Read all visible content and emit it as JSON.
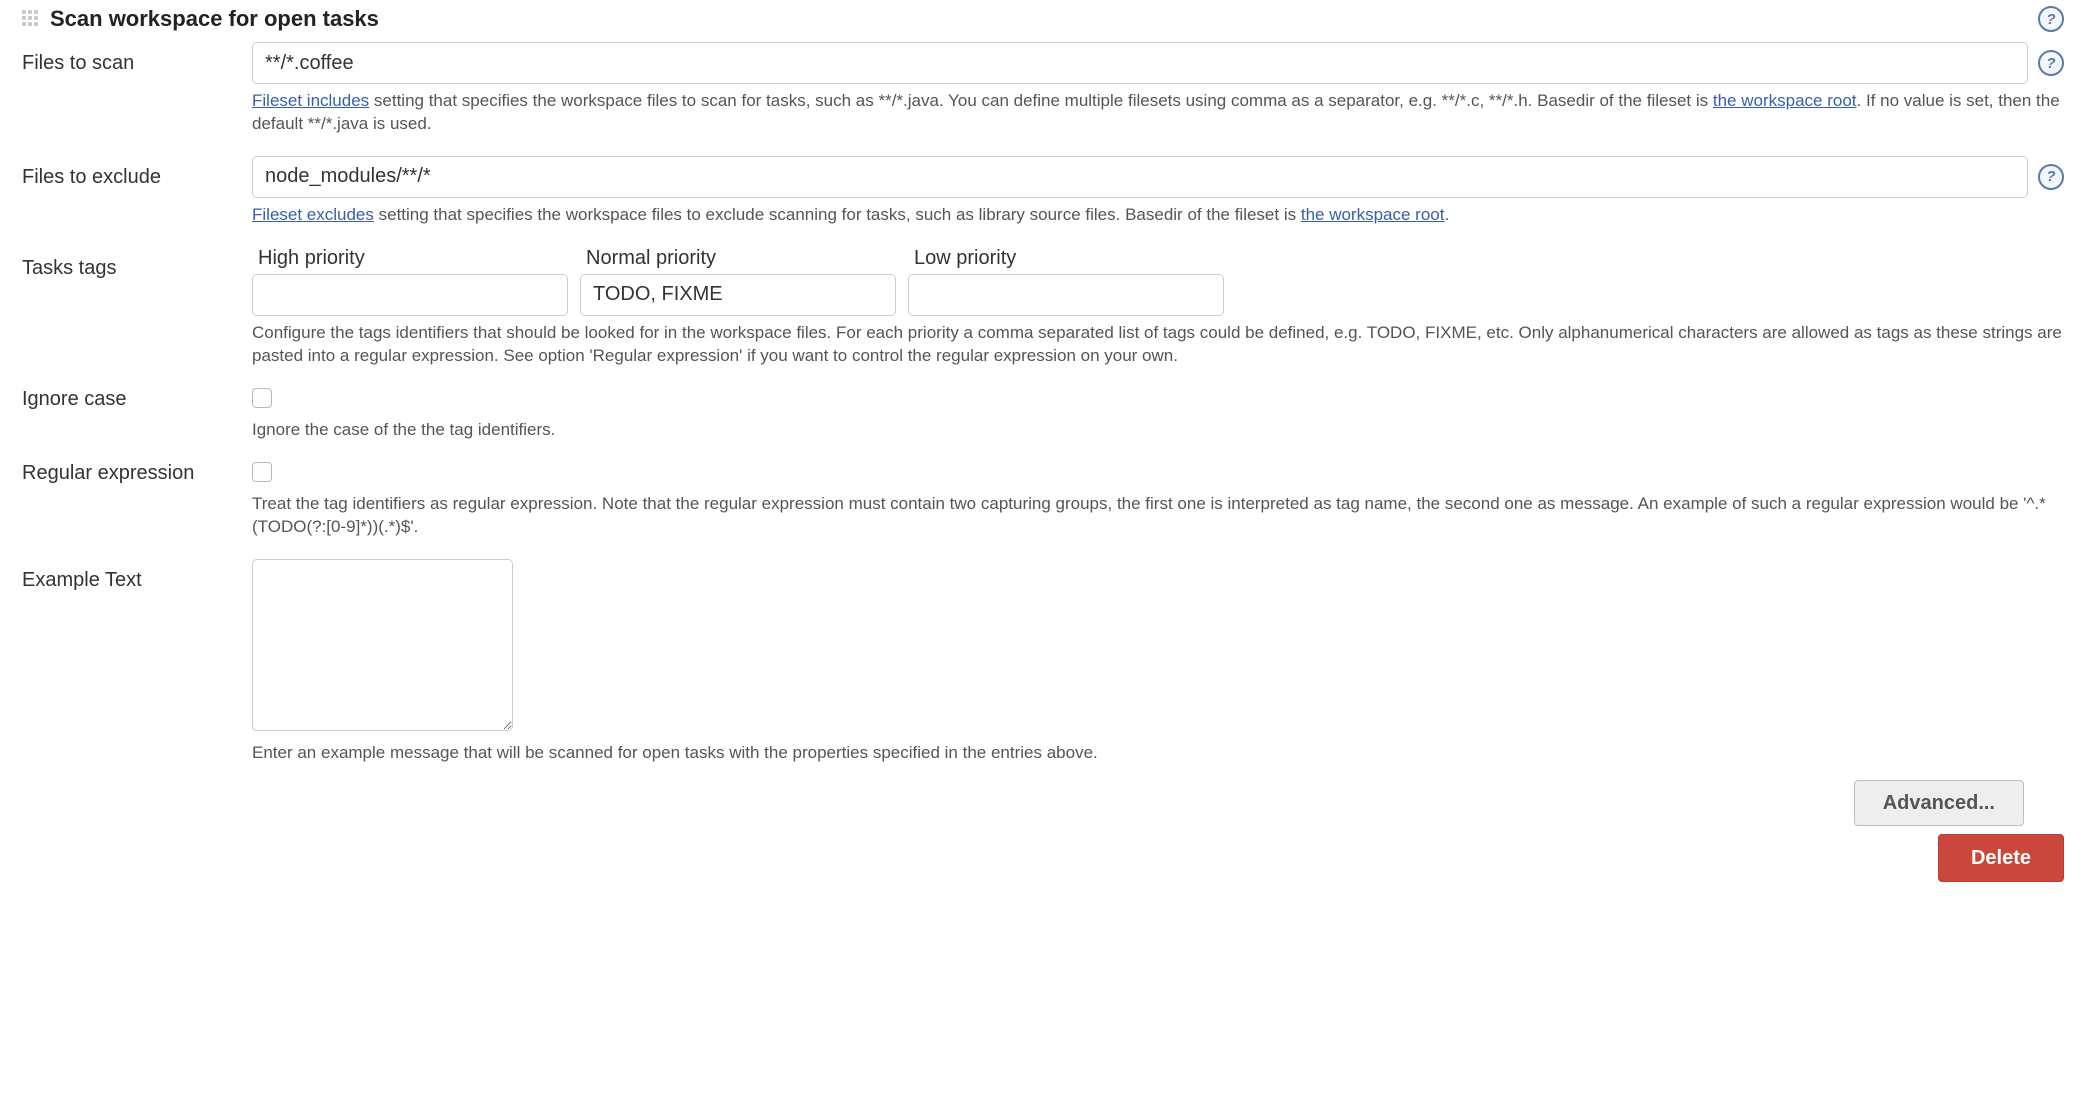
{
  "section": {
    "title": "Scan workspace for open tasks"
  },
  "files_to_scan": {
    "label": "Files to scan",
    "value": "**/*.coffee",
    "desc_prefix": " setting that specifies the workspace files to scan for tasks, such as **/*.java. You can define multiple filesets using comma as a separator, e.g. **/*.c, **/*.h. Basedir of the fileset is ",
    "desc_suffix": ". If no value is set, then the default **/*.java is used.",
    "link_includes": "Fileset includes",
    "link_root": "the workspace root"
  },
  "files_to_exclude": {
    "label": "Files to exclude",
    "value": "node_modules/**/*",
    "desc_prefix": " setting that specifies the workspace files to exclude scanning for tasks, such as library source files. Basedir of the fileset is ",
    "desc_suffix": ".",
    "link_excludes": "Fileset excludes",
    "link_root": "the workspace root"
  },
  "tasks_tags": {
    "label": "Tasks tags",
    "high_label": "High priority",
    "high_value": "",
    "normal_label": "Normal priority",
    "normal_value": "TODO, FIXME",
    "low_label": "Low priority",
    "low_value": "",
    "desc": "Configure the tags identifiers that should be looked for in the workspace files. For each priority a comma separated list of tags could be defined, e.g. TODO, FIXME, etc. Only alphanumerical characters are allowed as tags as these strings are pasted into a regular expression. See option 'Regular expression' if you want to control the regular expression on your own."
  },
  "ignore_case": {
    "label": "Ignore case",
    "desc": "Ignore the case of the the tag identifiers."
  },
  "regex": {
    "label": "Regular expression",
    "desc": "Treat the tag identifiers as regular expression. Note that the regular expression must contain two capturing groups, the first one is interpreted as tag name, the second one as message. An example of such a regular expression would be '^.*(TODO(?:[0-9]*))(.*)$'."
  },
  "example": {
    "label": "Example Text",
    "value": "",
    "desc": "Enter an example message that will be scanned for open tasks with the properties specified in the entries above."
  },
  "buttons": {
    "advanced": "Advanced...",
    "delete": "Delete"
  }
}
